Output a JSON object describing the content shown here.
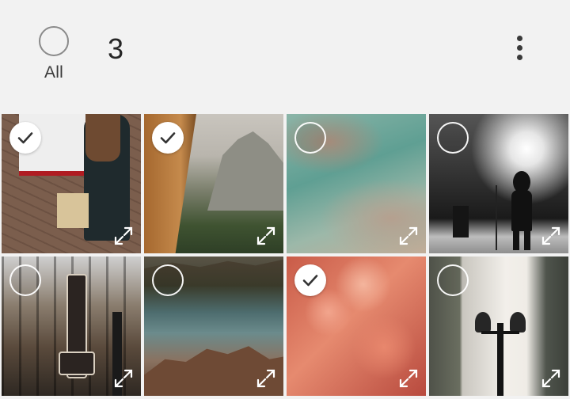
{
  "header": {
    "select_all_label": "All",
    "selected_count": "3",
    "more_icon": "more-vert-icon"
  },
  "colors": {
    "background": "#f2f2f2",
    "text": "#262626",
    "check_on": "#ffffff",
    "checkmark": "#333333"
  },
  "grid": {
    "tiles": [
      {
        "id": 1,
        "selected": true,
        "subject": "person-unloading-van"
      },
      {
        "id": 2,
        "selected": true,
        "subject": "rock-climber-cliff"
      },
      {
        "id": 3,
        "selected": false,
        "subject": "aerial-coastline"
      },
      {
        "id": 4,
        "selected": false,
        "subject": "concert-singer-silhouette"
      },
      {
        "id": 5,
        "selected": false,
        "subject": "street-restaurant-sign"
      },
      {
        "id": 6,
        "selected": false,
        "subject": "lake-rocks-forest"
      },
      {
        "id": 7,
        "selected": true,
        "subject": "pink-flower-closeup"
      },
      {
        "id": 8,
        "selected": false,
        "subject": "street-lamp-buildings"
      }
    ]
  }
}
